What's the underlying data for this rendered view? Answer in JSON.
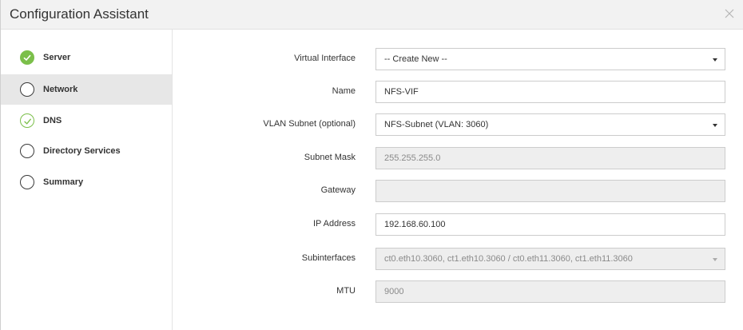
{
  "window": {
    "title": "Configuration Assistant"
  },
  "sidebar": {
    "steps": [
      {
        "label": "Server",
        "state": "completed"
      },
      {
        "label": "Network",
        "state": "active"
      },
      {
        "label": "DNS",
        "state": "checked"
      },
      {
        "label": "Directory Services",
        "state": "pending"
      },
      {
        "label": "Summary",
        "state": "pending"
      }
    ]
  },
  "form": {
    "virtual_interface": {
      "label": "Virtual Interface",
      "value": "-- Create New --"
    },
    "name": {
      "label": "Name",
      "value": "NFS-VIF"
    },
    "vlan_subnet": {
      "label": "VLAN Subnet (optional)",
      "value": "NFS-Subnet (VLAN: 3060)"
    },
    "subnet_mask": {
      "label": "Subnet Mask",
      "value": "255.255.255.0"
    },
    "gateway": {
      "label": "Gateway",
      "value": ""
    },
    "ip_address": {
      "label": "IP Address",
      "value": "192.168.60.100"
    },
    "subinterfaces": {
      "label": "Subinterfaces",
      "value": "ct0.eth10.3060, ct1.eth10.3060 / ct0.eth11.3060, ct1.eth11.3060"
    },
    "mtu": {
      "label": "MTU",
      "value": "9000"
    }
  },
  "colors": {
    "accent_green": "#7bbf4a",
    "active_bg": "#e7e7e7",
    "disabled_bg": "#eeeeee"
  },
  "icons": {
    "close": "close-icon",
    "completed": "check-circle-filled-icon",
    "checked": "check-circle-outline-icon",
    "pending": "empty-circle-icon",
    "dropdown": "chevron-down-icon"
  }
}
